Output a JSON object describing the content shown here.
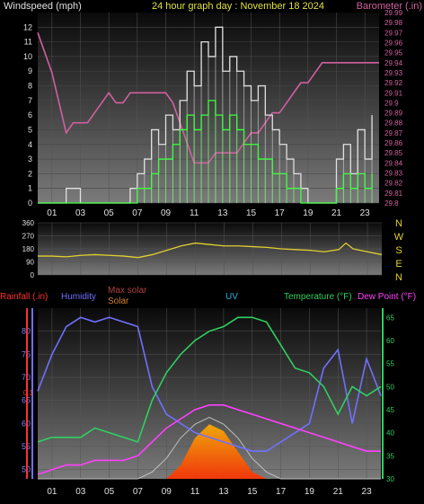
{
  "chart_data": [
    {
      "type": "line",
      "title": "24 hour graph day : November 18 2024",
      "ylabel_left": "Windspeed (mph)",
      "ylabel_right": "Barometer (.in)",
      "x_ticks": [
        "01",
        "03",
        "05",
        "07",
        "09",
        "11",
        "13",
        "15",
        "17",
        "19",
        "21",
        "23"
      ],
      "y_left_ticks": [
        0,
        1,
        2,
        3,
        4,
        5,
        6,
        7,
        8,
        9,
        10,
        11,
        12
      ],
      "ylim_left": [
        0,
        13
      ],
      "y_right_ticks": [
        "29.8",
        "29.81",
        "29.82",
        "29.83",
        "29.84",
        "29.85",
        "29.86",
        "29.87",
        "29.88",
        "29.89",
        "29.9",
        "29.91",
        "29.92",
        "29.93",
        "29.94",
        "29.95",
        "29.96",
        "29.97",
        "29.98",
        "29.99"
      ],
      "ylim_right": [
        29.8,
        29.99
      ],
      "series": [
        {
          "color": "#d060a0",
          "x": [
            0,
            0.5,
            1,
            1.5,
            2,
            2.5,
            3,
            3.5,
            4,
            4.5,
            5,
            5.5,
            6,
            6.5,
            7,
            7.5,
            8,
            8.5,
            9,
            9.5,
            10,
            10.5,
            11,
            11.5,
            12,
            12.5,
            13,
            13.5,
            14,
            14.5,
            15,
            15.5,
            16,
            16.5,
            17,
            17.5,
            18,
            18.5,
            19,
            19.5,
            20,
            20.5,
            21,
            21.5,
            22,
            22.5,
            23,
            23.5,
            24
          ],
          "values": [
            29.97,
            29.95,
            29.93,
            29.9,
            29.87,
            29.88,
            29.88,
            29.88,
            29.89,
            29.9,
            29.91,
            29.9,
            29.9,
            29.91,
            29.91,
            29.91,
            29.91,
            29.91,
            29.91,
            29.9,
            29.88,
            29.86,
            29.84,
            29.84,
            29.84,
            29.85,
            29.85,
            29.85,
            29.85,
            29.86,
            29.87,
            29.87,
            29.88,
            29.89,
            29.89,
            29.9,
            29.91,
            29.92,
            29.92,
            29.93,
            29.94,
            29.94,
            29.94,
            29.94,
            29.94,
            29.94,
            29.94,
            29.94,
            29.94
          ]
        },
        {
          "color": "#e0e0e0",
          "x": [
            0,
            1,
            2,
            3,
            4,
            5,
            6,
            6.5,
            7,
            7.5,
            8,
            8.5,
            9,
            9.5,
            10,
            10.5,
            11,
            11.5,
            12,
            12.5,
            13,
            13.5,
            14,
            14.5,
            15,
            15.5,
            16,
            16.5,
            17,
            17.5,
            18,
            18.5,
            19,
            19.5,
            20,
            20.5,
            21,
            21.5,
            22,
            22.5,
            23,
            23.5
          ],
          "values": [
            0,
            0,
            1,
            0,
            0,
            0,
            0,
            1,
            2,
            3,
            5,
            4,
            6,
            5,
            7,
            9,
            8,
            11,
            10,
            12,
            9,
            10,
            9,
            8,
            7,
            8,
            6,
            5,
            4,
            3,
            2,
            1,
            0,
            0,
            0,
            0,
            3,
            4,
            2,
            5,
            3,
            6
          ]
        },
        {
          "color": "#40ff40",
          "x": [
            0,
            1,
            2,
            3,
            4,
            5,
            6,
            6.5,
            7,
            7.5,
            8,
            8.5,
            9,
            9.5,
            10,
            10.5,
            11,
            11.5,
            12,
            12.5,
            13,
            13.5,
            14,
            14.5,
            15,
            15.5,
            16,
            16.5,
            17,
            17.5,
            18,
            18.5,
            19,
            19.5,
            20,
            20.5,
            21,
            21.5,
            22,
            22.5,
            23,
            23.5
          ],
          "values": [
            0,
            0,
            0,
            0,
            0,
            0,
            0,
            0,
            1,
            1,
            2,
            3,
            3,
            4,
            5,
            6,
            5,
            6,
            7,
            6,
            5,
            6,
            5,
            4,
            4,
            3,
            3,
            2,
            2,
            1,
            1,
            0,
            0,
            0,
            0,
            0,
            1,
            2,
            1,
            2,
            1,
            2
          ]
        }
      ]
    },
    {
      "type": "line",
      "ylabel_left_ticks": [
        0,
        90,
        180,
        270,
        360
      ],
      "ylabel_right": [
        "N",
        "W",
        "S",
        "E",
        "N"
      ],
      "ylim": [
        0,
        360
      ],
      "series": [
        {
          "color": "#e0d030",
          "x": [
            0,
            1,
            2,
            3,
            4,
            5,
            6,
            7,
            8,
            9,
            10,
            11,
            12,
            13,
            14,
            15,
            16,
            17,
            18,
            19,
            20,
            21,
            21.5,
            22,
            23,
            24
          ],
          "values": [
            130,
            130,
            125,
            135,
            140,
            135,
            130,
            120,
            140,
            170,
            200,
            220,
            210,
            200,
            200,
            195,
            190,
            180,
            175,
            170,
            160,
            175,
            220,
            180,
            160,
            140
          ]
        }
      ]
    },
    {
      "type": "line",
      "legend": [
        {
          "label": "Rainfall (.in)",
          "color": "#ff3030"
        },
        {
          "label": "Humidity",
          "color": "#7070ff"
        },
        {
          "label": "Max solar",
          "color": "#b04040"
        },
        {
          "label": "Solar",
          "color": "#d08030"
        },
        {
          "label": "UV",
          "color": "#30b0e0"
        },
        {
          "label": "Temperature (°F)",
          "color": "#30d060"
        },
        {
          "label": "Dew Point (°F)",
          "color": "#ff40ff"
        }
      ],
      "rain_ticks": [
        "0.1"
      ],
      "humidity_ticks": [
        50,
        55,
        60,
        65,
        70,
        75,
        80
      ],
      "temp_ticks": [
        30,
        35,
        40,
        45,
        50,
        55,
        60,
        65
      ],
      "ylim_humidity": [
        48,
        85
      ],
      "ylim_temp": [
        30,
        67
      ],
      "x": [
        0,
        1,
        2,
        3,
        4,
        5,
        6,
        7,
        8,
        9,
        10,
        11,
        12,
        13,
        14,
        15,
        16,
        17,
        18,
        19,
        20,
        21,
        22,
        23,
        24
      ],
      "series": [
        {
          "name": "Humidity",
          "color": "#7070ff",
          "values": [
            67,
            75,
            81,
            83,
            82,
            83,
            82,
            81,
            68,
            62,
            60,
            58,
            57,
            56,
            55,
            54,
            54,
            56,
            58,
            60,
            72,
            76,
            60,
            74,
            66
          ]
        },
        {
          "name": "Temperature (°F)",
          "color": "#30d060",
          "values": [
            38,
            39,
            39,
            39,
            41,
            40,
            39,
            38,
            47,
            53,
            57,
            60,
            62,
            63,
            65,
            65,
            64,
            59,
            54,
            53,
            50,
            44,
            50,
            48,
            50
          ]
        },
        {
          "name": "Dew Point (°F)",
          "color": "#ff40ff",
          "values": [
            31,
            32,
            33,
            33,
            34,
            34,
            34,
            35,
            38,
            41,
            43,
            45,
            46,
            46,
            45,
            44,
            43,
            42,
            41,
            40,
            39,
            38,
            37,
            36,
            36
          ]
        },
        {
          "name": "Solar",
          "color": "#d08030",
          "values": [
            0,
            0,
            0,
            0,
            0,
            0,
            0,
            0,
            0,
            0,
            2,
            6,
            8,
            7,
            4,
            1,
            0,
            0,
            0,
            0,
            0,
            0,
            0,
            0,
            0
          ]
        },
        {
          "name": "Max solar",
          "color": "#b04040",
          "values": [
            0,
            0,
            0,
            0,
            0,
            0,
            0,
            0,
            1,
            3,
            6,
            8,
            9,
            8,
            6,
            3,
            1,
            0,
            0,
            0,
            0,
            0,
            0,
            0,
            0
          ]
        }
      ]
    }
  ]
}
